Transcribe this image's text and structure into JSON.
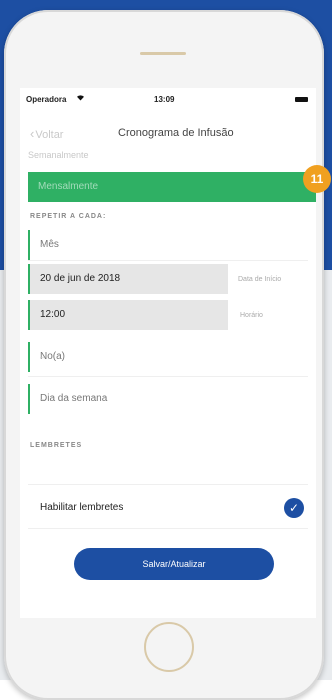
{
  "status_bar": {
    "carrier": "Operadora",
    "wifi_icon": "wifi-icon",
    "time": "13:09",
    "battery_icon": "battery-icon"
  },
  "nav": {
    "back_label": "Voltar",
    "title": "Cronograma de Infusão"
  },
  "frequency": {
    "prev_label": "Semanalmente",
    "selected": "Mensalmente",
    "highlight_color": "#2fb064"
  },
  "repeat_section": {
    "header": "REPETIR A CADA:",
    "unit_select": "Mês",
    "date_value": "20 de jun de 2018",
    "date_label": "Data de Início",
    "time_value": "12:00",
    "time_label": "Horário",
    "ordinal_select": "No(a)",
    "weekday_select": "Dia da semana"
  },
  "reminders_section": {
    "header": "LEMBRETES",
    "enable_label": "Habilitar lembretes",
    "enabled": true
  },
  "save_button_label": "Salvar/Atualizar",
  "step_badge": "11",
  "colors": {
    "accent_blue": "#1d4fa3",
    "badge_orange": "#f0a020"
  }
}
